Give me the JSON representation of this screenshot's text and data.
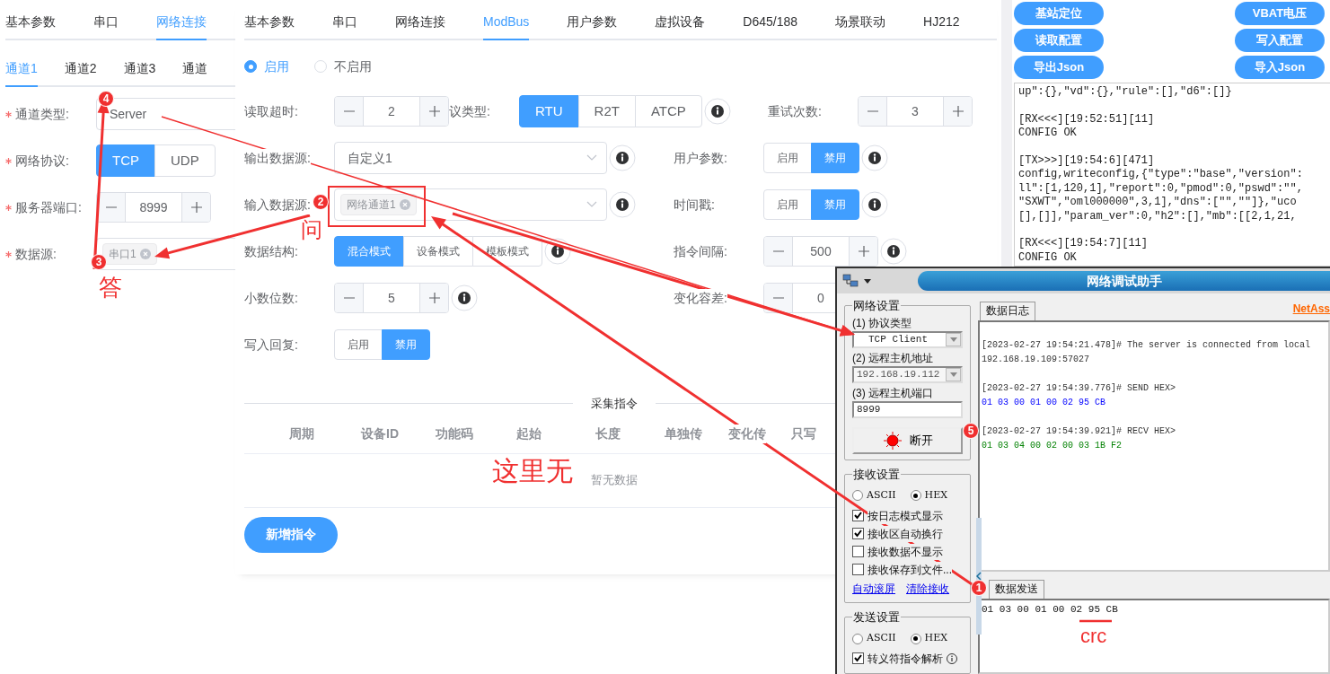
{
  "left_panel": {
    "tabs": [
      {
        "label": "基本参数",
        "selected": false
      },
      {
        "label": "串口",
        "selected": false
      },
      {
        "label": "网络连接",
        "selected": true
      }
    ],
    "channel_tabs": [
      {
        "label": "通道1",
        "selected": true
      },
      {
        "label": "通道2",
        "selected": false
      },
      {
        "label": "通道3",
        "selected": false
      },
      {
        "label": "通道",
        "selected": false
      }
    ],
    "fields": [
      {
        "kind": "select",
        "label": "通道类型:",
        "required": true,
        "value": "Server"
      },
      {
        "kind": "segmented",
        "label": "网络协议:",
        "required": true,
        "options": [
          {
            "label": "TCP",
            "selected": true
          },
          {
            "label": "UDP",
            "selected": false
          }
        ]
      },
      {
        "kind": "stepper",
        "label": "服务器端口:",
        "required": true,
        "value": "8999"
      },
      {
        "kind": "tags",
        "label": "数据源:",
        "required": true,
        "tags": [
          "串口1"
        ]
      }
    ]
  },
  "main_panel": {
    "tabs": [
      {
        "label": "基本参数",
        "selected": false
      },
      {
        "label": "串口",
        "selected": false
      },
      {
        "label": "网络连接",
        "selected": false
      },
      {
        "label": "ModBus",
        "selected": true
      },
      {
        "label": "用户参数",
        "selected": false
      },
      {
        "label": "虚拟设备",
        "selected": false
      },
      {
        "label": "D645/188",
        "selected": false
      },
      {
        "label": "场景联动",
        "selected": false
      },
      {
        "label": "HJ212",
        "selected": false
      }
    ],
    "enable": [
      {
        "label": "启用",
        "selected": true
      },
      {
        "label": "不启用",
        "selected": false
      }
    ],
    "rows": [
      [
        {
          "kind": "stepper",
          "label": "读取超时:",
          "value": "2"
        },
        {
          "kind": "segmented",
          "label": "议类型:",
          "info": true,
          "options": [
            {
              "label": "RTU",
              "selected": true
            },
            {
              "label": "R2T",
              "selected": false
            },
            {
              "label": "ATCP",
              "selected": false
            }
          ]
        },
        {
          "kind": "stepper",
          "label": "重试次数:",
          "value": "3"
        }
      ],
      [
        {
          "kind": "select",
          "label": "输出数据源:",
          "value": "自定义1",
          "info": true
        },
        {
          "kind": "radio_buttons",
          "label": "用户参数:",
          "info": true,
          "options": [
            {
              "label": "启用",
              "selected": false
            },
            {
              "label": "禁用",
              "selected": true
            }
          ]
        }
      ],
      [
        {
          "kind": "tags",
          "label": "输入数据源:",
          "tags": [
            "网络通道1"
          ],
          "info": true
        },
        {
          "kind": "radio_buttons",
          "label": "时间戳:",
          "info": true,
          "options": [
            {
              "label": "启用",
              "selected": false
            },
            {
              "label": "禁用",
              "selected": true
            }
          ]
        }
      ],
      [
        {
          "kind": "radio_buttons",
          "label": "数据结构:",
          "info": true,
          "options": [
            {
              "label": "混合模式",
              "selected": true
            },
            {
              "label": "设备模式",
              "selected": false
            },
            {
              "label": "模板模式",
              "selected": false
            }
          ]
        },
        {
          "kind": "stepper",
          "label": "指令间隔:",
          "value": "500",
          "info": true
        }
      ],
      [
        {
          "kind": "stepper",
          "label": "小数位数:",
          "value": "5",
          "info": true
        },
        {
          "kind": "stepper",
          "label": "变化容差:",
          "value": "0"
        }
      ],
      [
        {
          "kind": "radio_buttons",
          "label": "写入回复:",
          "options": [
            {
              "label": "启用",
              "selected": false
            },
            {
              "label": "禁用",
              "selected": true
            }
          ]
        }
      ]
    ],
    "section_title": "采集指令",
    "table": {
      "columns": [
        "周期",
        "设备ID",
        "功能码",
        "起始",
        "长度",
        "单独传",
        "变化传",
        "只写"
      ],
      "empty_text": "暂无数据"
    },
    "add_button": "新增指令"
  },
  "right_panel": {
    "buttons": [
      "基站定位",
      "VBAT电压",
      "读取配置",
      "写入配置",
      "导出Json",
      "导入Json"
    ],
    "log": [
      [
        "up\":{},\"vd\":{},\"rule\":[],\"d6\":[]}"
      ],
      [
        "[RX<<<][19:52:51][11]",
        "CONFIG OK"
      ],
      [
        "[TX>>>][19:54:6][471]",
        "config,writeconfig,{\"type\":\"base\",\"version\":",
        "ll\":[1,120,1],\"report\":0,\"pmod\":0,\"pswd\":\"\",",
        "\"SXWT\",\"oml000000\",3,1],\"dns\":[\"\",\"\"]},\"uco",
        "[],[]],\"param_ver\":0,\"h2\":[],\"mb\":[[2,1,21,"
      ],
      [
        "[RX<<<][19:54:7][11]",
        "CONFIG OK"
      ]
    ]
  },
  "net_tool": {
    "title": "网络调试助手",
    "network_group": {
      "title": "网络设置",
      "fields": [
        {
          "kind": "select",
          "label": "(1) 协议类型",
          "value": "TCP Client"
        },
        {
          "kind": "combo",
          "label": "(2) 远程主机地址",
          "value": "192.168.19.112"
        },
        {
          "kind": "input",
          "label": "(3) 远程主机端口",
          "value": "8999"
        }
      ],
      "connect_button": "断开"
    },
    "receive_group": {
      "title": "接收设置",
      "modes": [
        {
          "label": "ASCII",
          "selected": false
        },
        {
          "label": "HEX",
          "selected": true
        }
      ],
      "options": [
        {
          "label": "按日志模式显示",
          "checked": true
        },
        {
          "label": "接收区自动换行",
          "checked": true
        },
        {
          "label": "接收数据不显示",
          "checked": false
        },
        {
          "label": "接收保存到文件...",
          "checked": false
        }
      ],
      "links": [
        "自动滚屏",
        "清除接收"
      ]
    },
    "send_group": {
      "title": "发送设置",
      "modes": [
        {
          "label": "ASCII",
          "selected": false
        },
        {
          "label": "HEX",
          "selected": true
        }
      ],
      "options": [
        {
          "label": "转义符指令解析",
          "checked": true
        }
      ]
    },
    "log_tab": "数据日志",
    "brand": "NetAss",
    "log": [
      {
        "kind": "info",
        "lines": [
          "[2023-02-27 19:54:21.478]# The server is connected from local",
          "192.168.19.109:57027"
        ]
      },
      {
        "kind": "send",
        "lines": [
          "[2023-02-27 19:54:39.776]# SEND HEX>",
          "01 03 00 01 00 02 95 CB"
        ]
      },
      {
        "kind": "recv",
        "lines": [
          "[2023-02-27 19:54:39.921]# RECV HEX>",
          "01 03 04 00 02 00 03 1B F2"
        ]
      }
    ],
    "send_tab": "数据发送",
    "send_text": "01 03 00 01 00 02 95 CB"
  },
  "annotations": {
    "badges": [
      "1",
      "2",
      "3",
      "4",
      "5"
    ],
    "notes": [
      "问",
      "答",
      "这里无",
      "crc"
    ]
  }
}
